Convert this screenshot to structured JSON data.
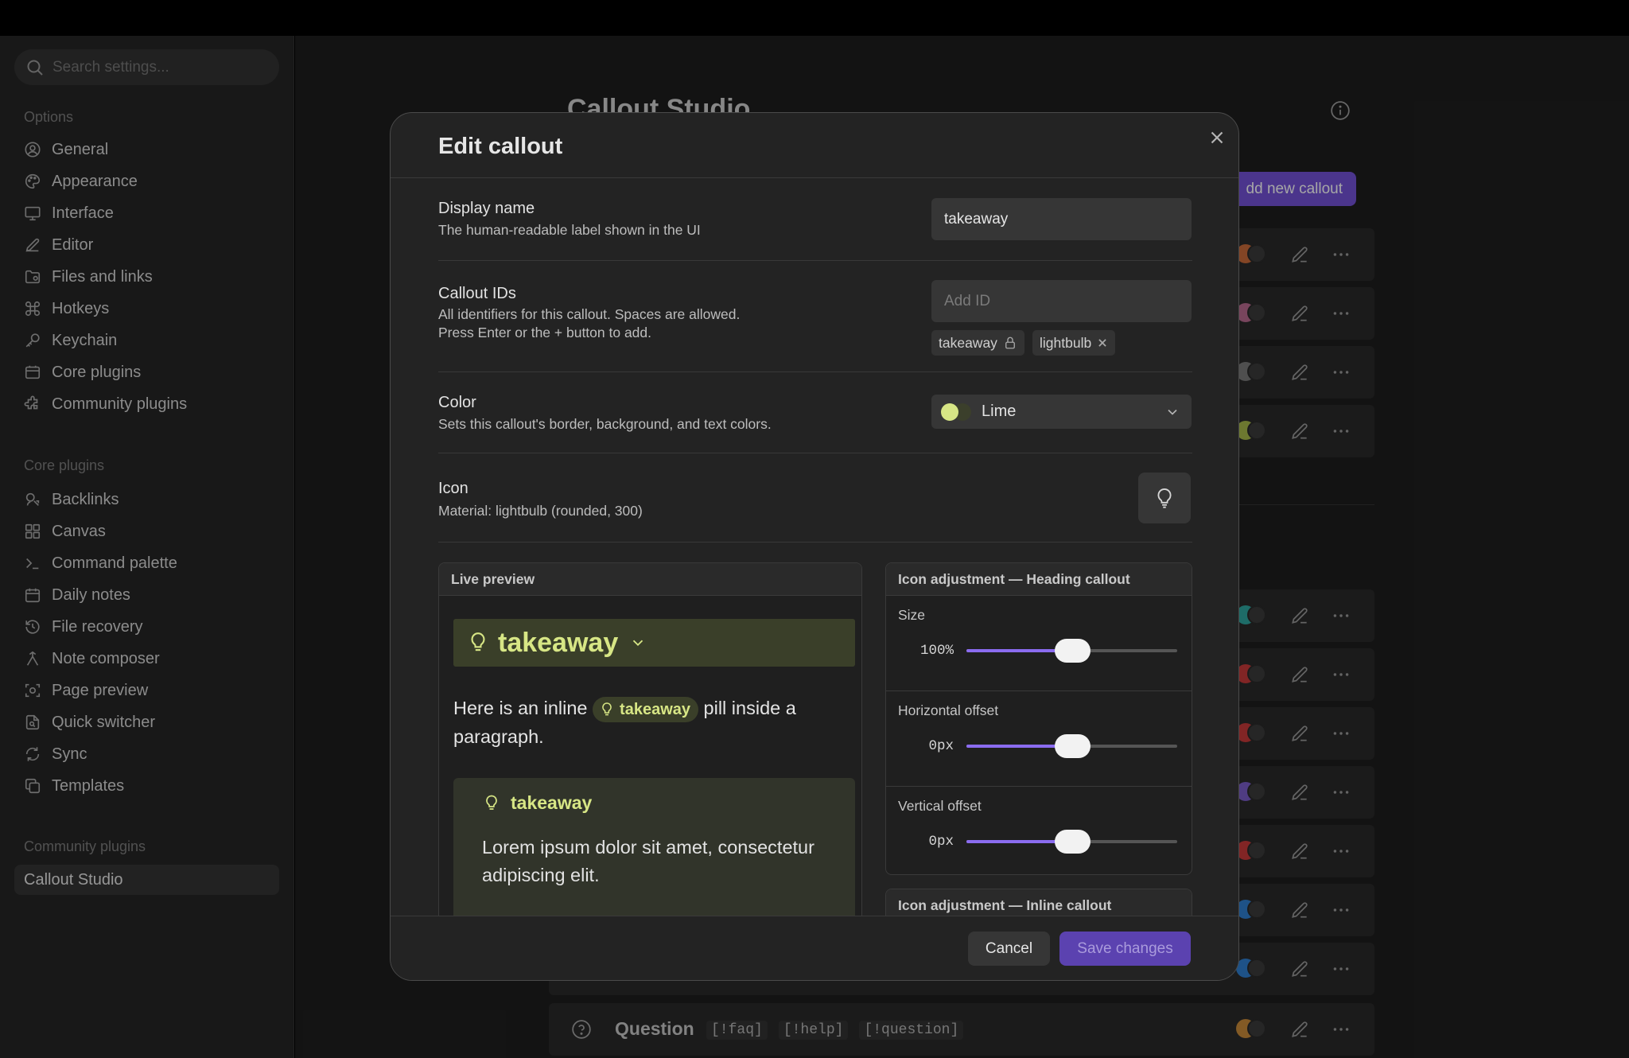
{
  "sidebar": {
    "search_placeholder": "Search settings...",
    "options_title": "Options",
    "options": [
      {
        "label": "General",
        "icon": "settings-circle-icon"
      },
      {
        "label": "Appearance",
        "icon": "palette-icon"
      },
      {
        "label": "Interface",
        "icon": "monitor-icon"
      },
      {
        "label": "Editor",
        "icon": "pencil-icon"
      },
      {
        "label": "Files and links",
        "icon": "folder-icon"
      },
      {
        "label": "Hotkeys",
        "icon": "command-icon"
      },
      {
        "label": "Keychain",
        "icon": "key-icon"
      },
      {
        "label": "Core plugins",
        "icon": "calendar-box-icon"
      },
      {
        "label": "Community plugins",
        "icon": "puzzle-icon"
      }
    ],
    "core_title": "Core plugins",
    "core": [
      {
        "label": "Backlinks",
        "icon": "backlinks-icon"
      },
      {
        "label": "Canvas",
        "icon": "grid-icon"
      },
      {
        "label": "Command palette",
        "icon": "terminal-icon"
      },
      {
        "label": "Daily notes",
        "icon": "calendar-icon"
      },
      {
        "label": "File recovery",
        "icon": "history-icon"
      },
      {
        "label": "Note composer",
        "icon": "merge-icon"
      },
      {
        "label": "Page preview",
        "icon": "preview-icon"
      },
      {
        "label": "Quick switcher",
        "icon": "file-search-icon"
      },
      {
        "label": "Sync",
        "icon": "sync-icon"
      },
      {
        "label": "Templates",
        "icon": "copy-icon"
      }
    ],
    "community_title": "Community plugins",
    "community": [
      {
        "label": "Callout Studio",
        "active": true
      }
    ]
  },
  "page": {
    "title": "Callout Studio",
    "add_button": "dd new callout",
    "rows": [
      {
        "color": "#c96a3a"
      },
      {
        "color": "#b86a8f"
      },
      {
        "color": "#7a7a7a"
      },
      {
        "color": "#a8b84a"
      },
      {
        "color": "#2fa6a0"
      },
      {
        "color": "#c73a3a"
      },
      {
        "color": "#c73a3a"
      },
      {
        "color": "#7a5cc8"
      },
      {
        "color": "#c73a3a"
      },
      {
        "color": "#2f7fd0"
      },
      {
        "color": "#2f7fd0"
      }
    ],
    "question_row": {
      "name": "Question",
      "ids": [
        "[!faq]",
        "[!help]",
        "[!question]"
      ],
      "color": "#c98a3a"
    }
  },
  "modal": {
    "title": "Edit callout",
    "display_name": {
      "label": "Display name",
      "desc": "The human-readable label shown in the UI",
      "value": "takeaway"
    },
    "callout_ids": {
      "label": "Callout IDs",
      "desc1": "All identifiers for this callout. Spaces are allowed.",
      "desc2": "Press Enter or the + button to add.",
      "placeholder": "Add ID",
      "chips": [
        {
          "label": "takeaway",
          "icon": "lock-icon"
        },
        {
          "label": "lightbulb",
          "icon": "remove-x-icon"
        }
      ]
    },
    "color": {
      "label": "Color",
      "desc": "Sets this callout's border, background, and text colors.",
      "value": "Lime",
      "accent": "#d7e685"
    },
    "icon": {
      "label": "Icon",
      "desc": "Material: lightbulb (rounded, 300)",
      "glyph": "lightbulb-icon"
    },
    "preview": {
      "title": "Live preview",
      "heading": "takeaway",
      "para_before": "Here is an inline",
      "pill": "takeaway",
      "para_after": "pill inside a paragraph.",
      "block_title": "takeaway",
      "block_text": "Lorem ipsum dolor sit amet, consectetur adipiscing elit."
    },
    "heading_adjust": {
      "title": "Icon adjustment — Heading callout",
      "rows": [
        {
          "label": "Size",
          "value": "100%",
          "fill": 0.5
        },
        {
          "label": "Horizontal offset",
          "value": "0px",
          "fill": 0.5
        },
        {
          "label": "Vertical offset",
          "value": "0px",
          "fill": 0.5
        }
      ]
    },
    "inline_adjust": {
      "title": "Icon adjustment — Inline callout"
    },
    "cancel": "Cancel",
    "save": "Save changes"
  }
}
